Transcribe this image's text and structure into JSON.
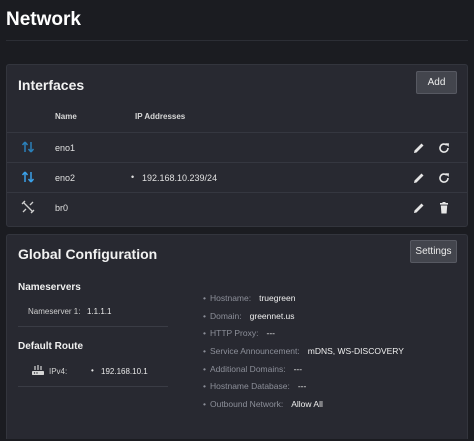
{
  "page": {
    "title": "Network"
  },
  "interfaces": {
    "title": "Interfaces",
    "add_label": "Add",
    "columns": {
      "name": "Name",
      "ip": "IP Addresses"
    },
    "rows": [
      {
        "name": "eno1",
        "ip": "",
        "icon": "arrows-updown-icon",
        "icon_color": "#2a7fb8",
        "actions": [
          "edit-icon",
          "refresh-icon"
        ]
      },
      {
        "name": "eno2",
        "ip": "192.168.10.239/24",
        "icon": "arrows-updown-icon",
        "icon_color": "#3aa0e8",
        "actions": [
          "edit-icon",
          "refresh-icon"
        ]
      },
      {
        "name": "br0",
        "ip": "",
        "icon": "bridge-icon",
        "icon_color": "#cfcfcf",
        "actions": [
          "edit-icon",
          "delete-icon"
        ]
      }
    ]
  },
  "global": {
    "title": "Global Configuration",
    "settings_label": "Settings",
    "nameservers": {
      "heading": "Nameservers",
      "items": [
        {
          "label": "Nameserver 1:",
          "value": "1.1.1.1"
        }
      ]
    },
    "default_route": {
      "heading": "Default Route",
      "items": [
        {
          "label": "IPv4:",
          "value": "192.168.10.1"
        }
      ]
    },
    "details": [
      {
        "key": "Hostname:",
        "value": "truegreen"
      },
      {
        "key": "Domain:",
        "value": "greennet.us"
      },
      {
        "key": "HTTP Proxy:",
        "value": "---"
      },
      {
        "key": "Service Announcement:",
        "value": "mDNS, WS-DISCOVERY"
      },
      {
        "key": "Additional Domains:",
        "value": "---"
      },
      {
        "key": "Hostname Database:",
        "value": "---"
      },
      {
        "key": "Outbound Network:",
        "value": "Allow All"
      }
    ]
  },
  "colors": {
    "background": "#1b1c21",
    "card": "#282931",
    "accent_blue": "#3aa0e8"
  }
}
